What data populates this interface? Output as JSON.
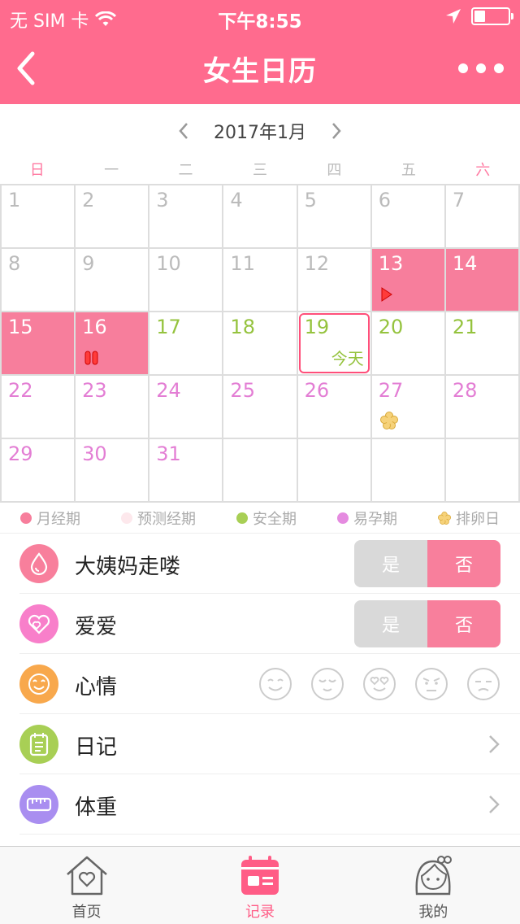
{
  "status": {
    "carrier": "无 SIM 卡",
    "time": "下午8:55",
    "battery_level": 0.3
  },
  "header": {
    "title": "女生日历"
  },
  "calendar": {
    "month_label": "2017年1月",
    "weekdays": [
      "日",
      "一",
      "二",
      "三",
      "四",
      "五",
      "六"
    ],
    "weekday_colors": [
      "#ff7aa2",
      "#bbbbbb",
      "#bbbbbb",
      "#bbbbbb",
      "#bbbbbb",
      "#bbbbbb",
      "#ff7aa2"
    ],
    "days": [
      {
        "n": "1",
        "state": "past"
      },
      {
        "n": "2",
        "state": "past"
      },
      {
        "n": "3",
        "state": "past"
      },
      {
        "n": "4",
        "state": "past"
      },
      {
        "n": "5",
        "state": "past"
      },
      {
        "n": "6",
        "state": "past"
      },
      {
        "n": "7",
        "state": "past"
      },
      {
        "n": "8",
        "state": "past"
      },
      {
        "n": "9",
        "state": "past"
      },
      {
        "n": "10",
        "state": "past"
      },
      {
        "n": "11",
        "state": "past"
      },
      {
        "n": "12",
        "state": "past"
      },
      {
        "n": "13",
        "state": "period",
        "mark": "start"
      },
      {
        "n": "14",
        "state": "period"
      },
      {
        "n": "15",
        "state": "period"
      },
      {
        "n": "16",
        "state": "period",
        "mark": "pause"
      },
      {
        "n": "17",
        "state": "safe"
      },
      {
        "n": "18",
        "state": "safe"
      },
      {
        "n": "19",
        "state": "safe",
        "today": "今天"
      },
      {
        "n": "20",
        "state": "safe"
      },
      {
        "n": "21",
        "state": "safe"
      },
      {
        "n": "22",
        "state": "fertile"
      },
      {
        "n": "23",
        "state": "fertile"
      },
      {
        "n": "24",
        "state": "fertile"
      },
      {
        "n": "25",
        "state": "fertile"
      },
      {
        "n": "26",
        "state": "fertile"
      },
      {
        "n": "27",
        "state": "fertile",
        "mark": "ovulation"
      },
      {
        "n": "28",
        "state": "fertile"
      },
      {
        "n": "29",
        "state": "fertile"
      },
      {
        "n": "30",
        "state": "fertile"
      },
      {
        "n": "31",
        "state": "fertile"
      },
      {
        "n": "",
        "state": "empty"
      },
      {
        "n": "",
        "state": "empty"
      },
      {
        "n": "",
        "state": "empty"
      },
      {
        "n": "",
        "state": "empty"
      }
    ]
  },
  "legend": [
    {
      "label": "月经期",
      "color": "#f77e9c"
    },
    {
      "label": "预测经期",
      "color": "#fde8ec"
    },
    {
      "label": "安全期",
      "color": "#a8cf55"
    },
    {
      "label": "易孕期",
      "color": "#e58be0"
    },
    {
      "label": "排卵日",
      "color": "#f3cc6a"
    }
  ],
  "records": {
    "period": {
      "label": "大姨妈走喽",
      "yes": "是",
      "no": "否",
      "icon": "water-drop-icon",
      "color": "#f87f9c"
    },
    "love": {
      "label": "爱爱",
      "yes": "是",
      "no": "否",
      "icon": "hearts-icon",
      "color": "#f87fca"
    },
    "mood": {
      "label": "心情",
      "icon": "smile-icon",
      "color": "#f8a84c",
      "faces": [
        "smile-face-icon",
        "content-face-icon",
        "love-face-icon",
        "angry-face-icon",
        "sad-face-icon"
      ]
    },
    "diary": {
      "label": "日记",
      "icon": "notebook-icon",
      "color": "#a8cf55"
    },
    "weight": {
      "label": "体重",
      "icon": "ruler-icon",
      "color": "#a98ef0"
    }
  },
  "tabs": [
    {
      "label": "首页",
      "icon": "home-heart-icon",
      "active": false
    },
    {
      "label": "记录",
      "icon": "calendar-record-icon",
      "active": true
    },
    {
      "label": "我的",
      "icon": "girl-avatar-icon",
      "active": false
    }
  ]
}
